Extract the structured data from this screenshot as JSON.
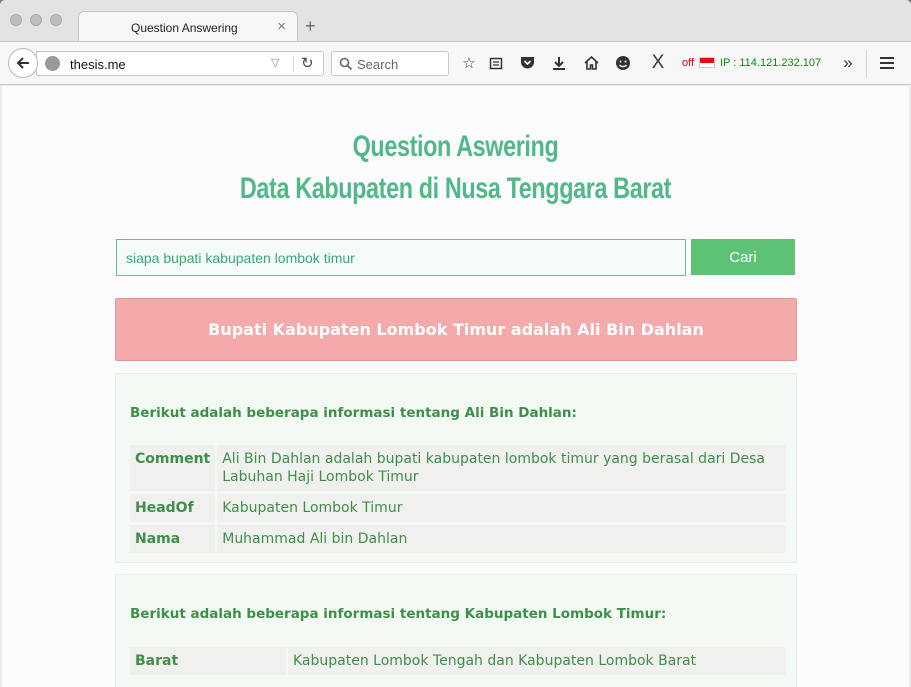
{
  "browser": {
    "tab_title": "Question Answering",
    "url": "thesis.me",
    "search_placeholder": "Search",
    "extension_status": "off",
    "ip_text": "IP : 114.121.232.107"
  },
  "page": {
    "title_line1": "Question Aswering",
    "title_line2": "Data Kabupaten di Nusa Tenggara Barat",
    "query": "siapa bupati kabupaten lombok timur",
    "search_button": "Cari",
    "answer": "Bupati Kabupaten Lombok Timur adalah Ali Bin Dahlan",
    "cards": [
      {
        "heading": "Berikut adalah beberapa informasi tentang Ali Bin Dahlan:",
        "rows": [
          {
            "key": "Comment",
            "value": "Ali Bin Dahlan adalah bupati kabupaten lombok timur yang berasal dari Desa Labuhan Haji Lombok Timur"
          },
          {
            "key": "HeadOf",
            "value": "Kabupaten Lombok Timur"
          },
          {
            "key": "Nama",
            "value": "Muhammad Ali bin Dahlan"
          }
        ]
      },
      {
        "heading": "Berikut adalah beberapa informasi tentang Kabupaten Lombok Timur:",
        "rows": [
          {
            "key": "Barat",
            "value": "Kabupaten Lombok Tengah dan Kabupaten Lombok Barat"
          }
        ]
      }
    ]
  },
  "colors": {
    "accent_green": "#51b88a",
    "button_green": "#5ec276",
    "answer_pink": "#f4a9aa",
    "text_green": "#3f8f4a"
  }
}
